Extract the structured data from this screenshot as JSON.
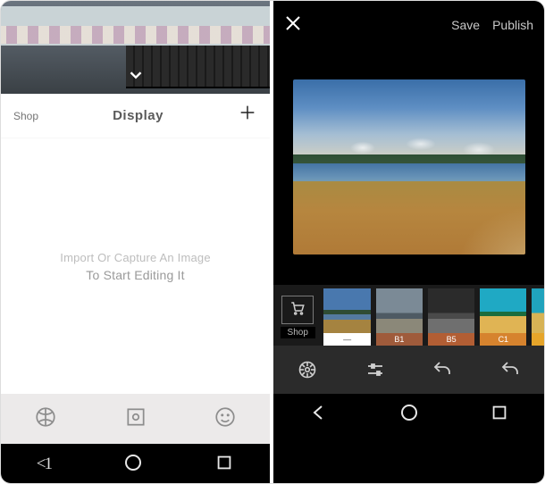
{
  "left": {
    "header": {
      "shop": "Shop",
      "title": "Display",
      "plus": "+"
    },
    "empty": {
      "line1": "Import Or Capture An Image",
      "line2": "To Start Editing It"
    },
    "nav": {
      "back_label": "<1"
    }
  },
  "right": {
    "top": {
      "save": "Save",
      "publish": "Publish"
    },
    "shop": {
      "label": "Shop"
    },
    "filters": [
      {
        "id": "normal",
        "label": "—",
        "selected": true
      },
      {
        "id": "b1",
        "label": "B1",
        "selected": false
      },
      {
        "id": "b5",
        "label": "B5",
        "selected": false
      },
      {
        "id": "c1",
        "label": "C1",
        "selected": false
      }
    ]
  }
}
